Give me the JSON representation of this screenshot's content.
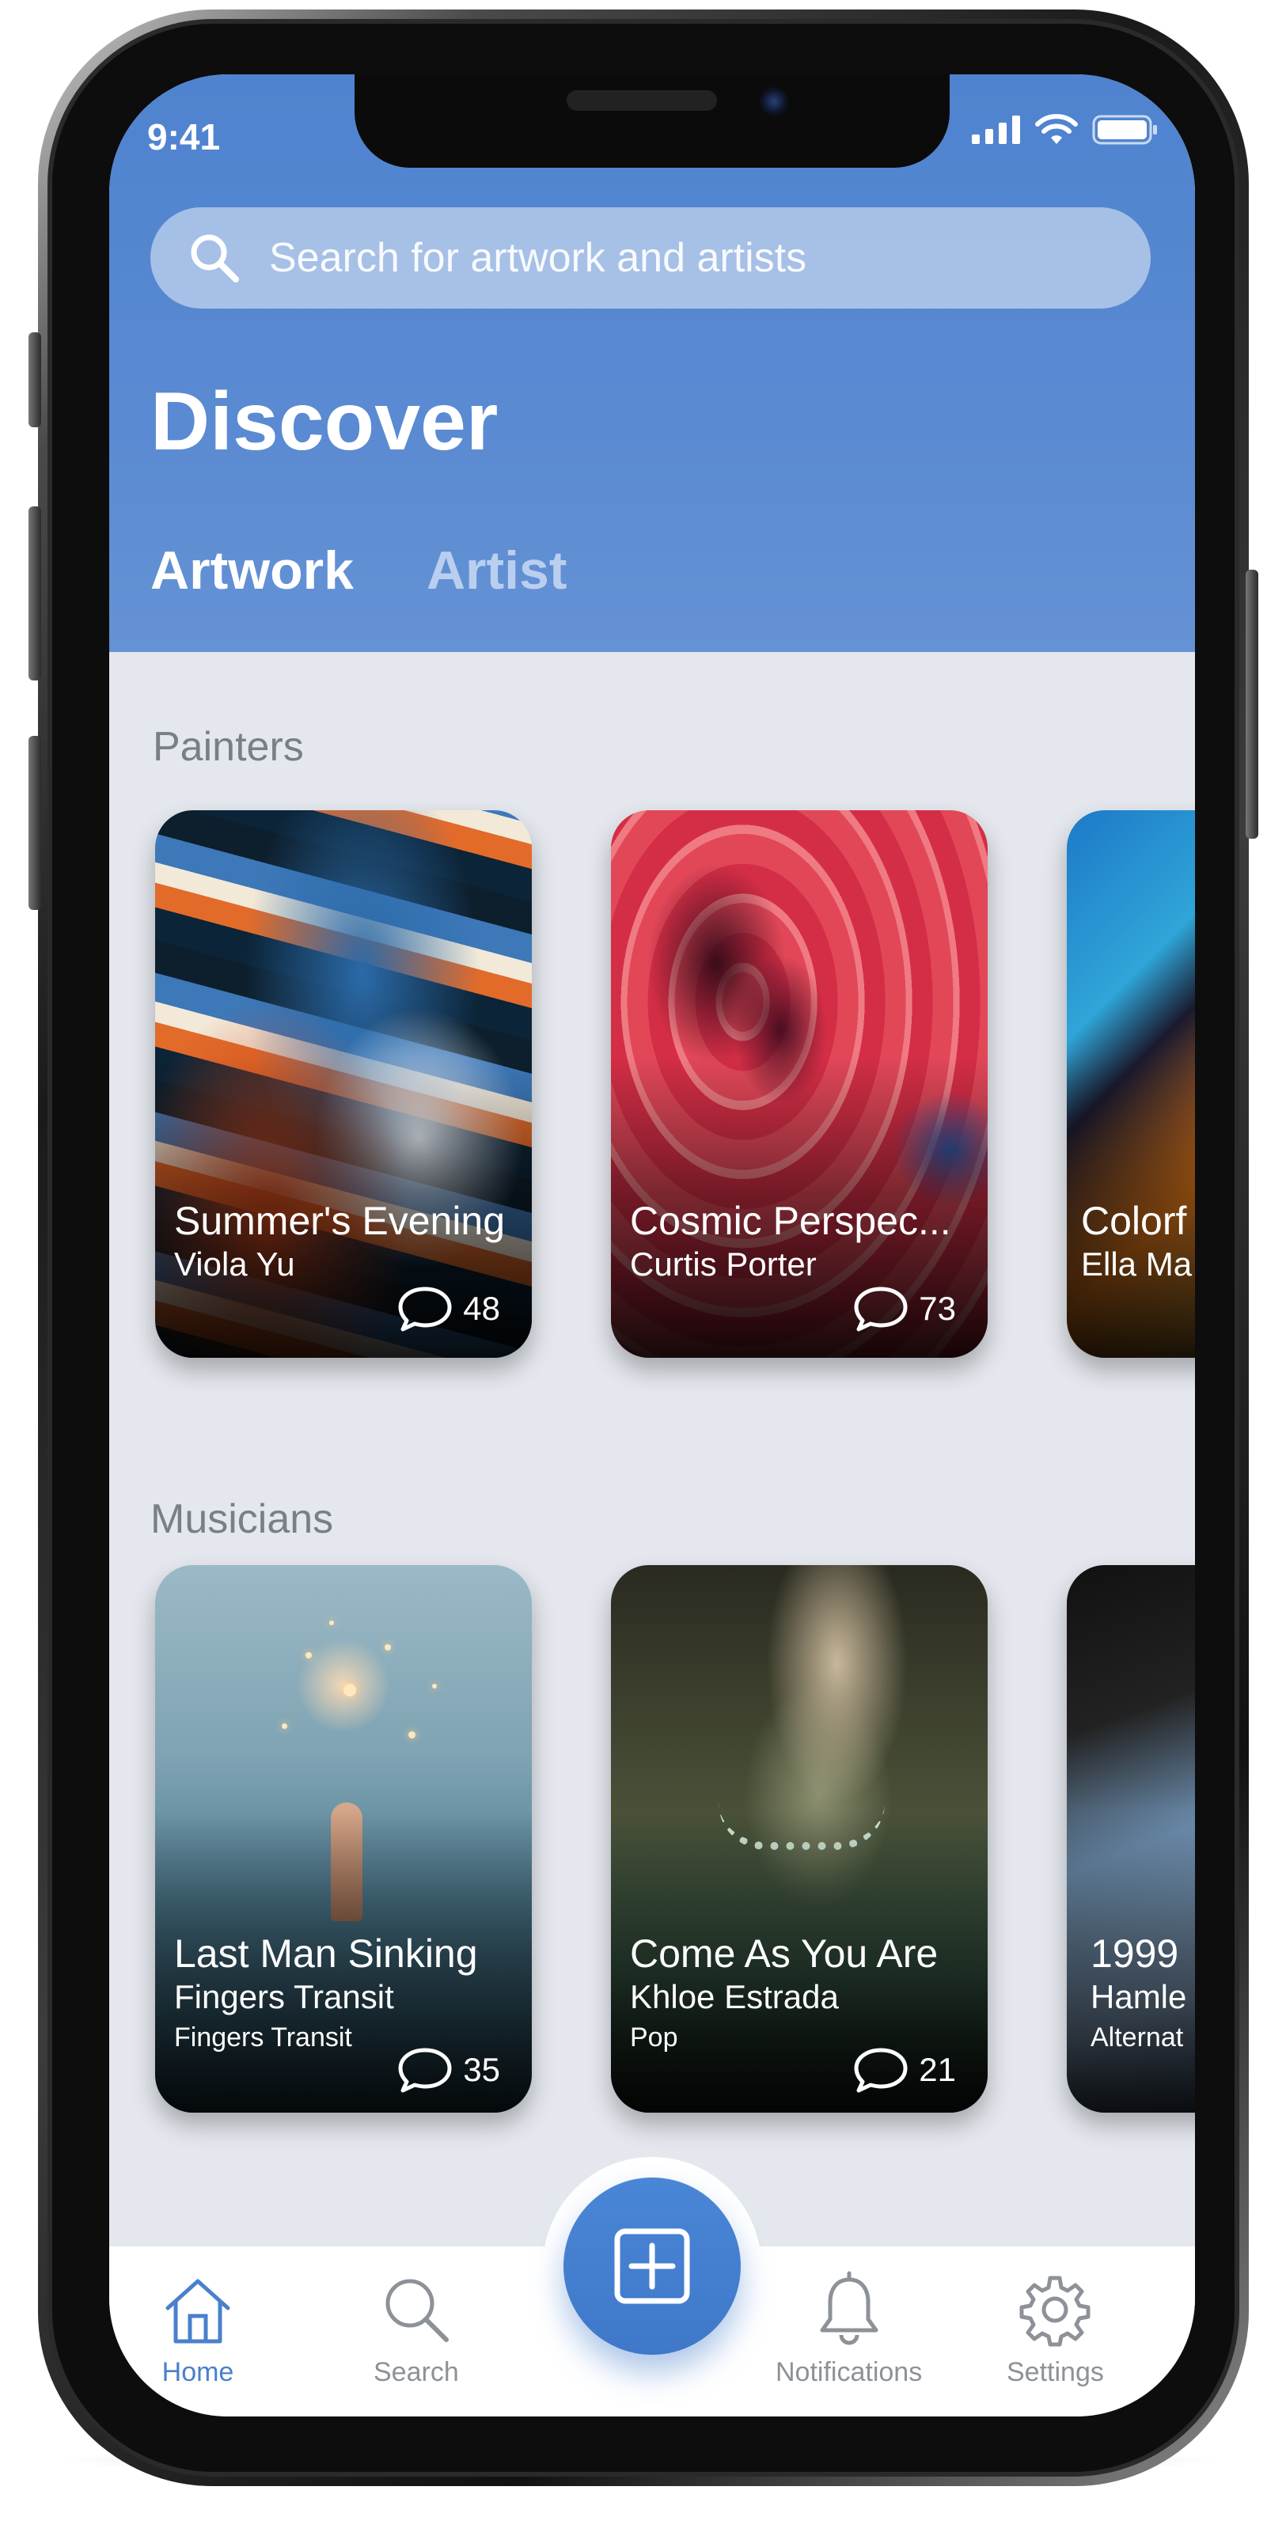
{
  "status_bar": {
    "time": "9:41"
  },
  "search": {
    "placeholder": "Search for artwork and artists"
  },
  "header": {
    "title": "Discover"
  },
  "tabs": [
    {
      "label": "Artwork",
      "active": true
    },
    {
      "label": "Artist",
      "active": false
    }
  ],
  "sections": [
    {
      "title": "Painters",
      "cards": [
        {
          "title": "Summer's Evening",
          "artist": "Viola Yu",
          "comments": "48"
        },
        {
          "title": "Cosmic Perspec...",
          "artist": "Curtis Porter",
          "comments": "73"
        },
        {
          "title": "Colorf",
          "artist": "Ella Ma",
          "comments": ""
        }
      ]
    },
    {
      "title": "Musicians",
      "cards": [
        {
          "title": "Last Man Sinking",
          "artist": "Fingers Transit",
          "genre": "Fingers Transit",
          "comments": "35"
        },
        {
          "title": "Come As You Are",
          "artist": "Khloe Estrada",
          "genre": "Pop",
          "comments": "21"
        },
        {
          "title": "1999",
          "artist": "Hamle",
          "genre": "Alternat",
          "comments": ""
        }
      ]
    }
  ],
  "bottom_nav": [
    {
      "label": "Home",
      "icon": "home-icon",
      "active": true
    },
    {
      "label": "Search",
      "icon": "search-icon",
      "active": false
    },
    {
      "label": "",
      "icon": "add-icon",
      "active": false
    },
    {
      "label": "Notifications",
      "icon": "bell-icon",
      "active": false
    },
    {
      "label": "Settings",
      "icon": "gear-icon",
      "active": false
    }
  ],
  "colors": {
    "header_blue": "#5588d0",
    "accent": "#4a80cc",
    "background": "#e4e8ee"
  }
}
